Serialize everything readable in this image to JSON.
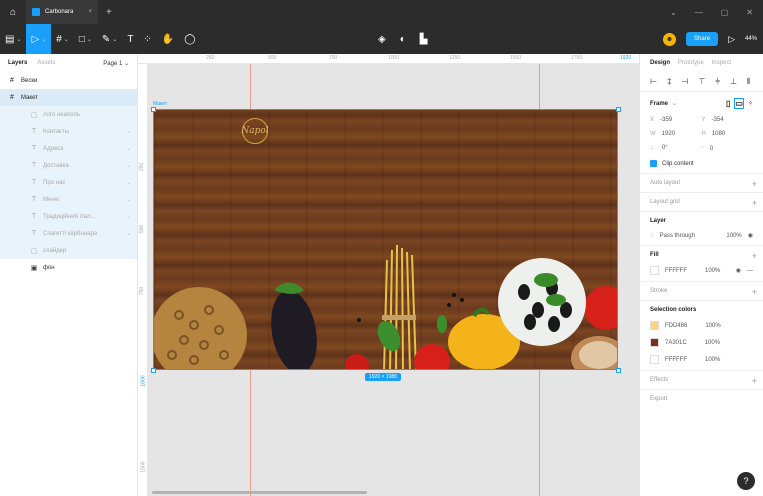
{
  "tab": {
    "title": "Carbonara",
    "close": "×",
    "new": "+"
  },
  "toolbar": {
    "share_label": "Share",
    "zoom": "44%",
    "avatar_initial": "☻"
  },
  "left_panel": {
    "tabs": [
      "Layers",
      "Assets"
    ],
    "page": "Page 1",
    "layers": [
      {
        "name": "Вески",
        "icon": "#"
      },
      {
        "name": "Макет",
        "icon": "#"
      }
    ],
    "children": [
      {
        "name": "лого неаполь",
        "icon": "▢"
      },
      {
        "name": "Контакты",
        "icon": "T"
      },
      {
        "name": "Адреса",
        "icon": "T"
      },
      {
        "name": "Доставка",
        "icon": "T"
      },
      {
        "name": "Про нас",
        "icon": "T"
      },
      {
        "name": "Меню",
        "icon": "T"
      },
      {
        "name": "Традиційний італ...",
        "icon": "T"
      },
      {
        "name": "Спагетті карбонара",
        "icon": "T"
      },
      {
        "name": "слайдер",
        "icon": "▢"
      },
      {
        "name": "фон",
        "icon": "▣"
      }
    ]
  },
  "rulers": {
    "top": [
      "250",
      "500",
      "750",
      "1000",
      "1250",
      "1500",
      "1750",
      "1920"
    ],
    "left": [
      "250",
      "500",
      "750",
      "1000",
      "1500"
    ]
  },
  "canvas": {
    "frame_name": "Макет",
    "size_label": "1920 × 1080",
    "logo_text": "Napol"
  },
  "right_panel": {
    "tabs": [
      "Design",
      "Prototype",
      "Inspect"
    ],
    "frame": {
      "title": "Frame",
      "x": "-359",
      "y": "-354",
      "w": "1920",
      "h": "1080",
      "rotation": "0°",
      "radius": "0",
      "clip_content": "Clip content"
    },
    "auto_layout": "Auto layout",
    "layout_grid": "Layout grid",
    "layer": {
      "title": "Layer",
      "blend": "Pass through",
      "opacity": "100%"
    },
    "fill": {
      "title": "Fill",
      "color": "FFFFFF",
      "opacity": "100%"
    },
    "stroke": "Stroke",
    "selection_colors": {
      "title": "Selection colors",
      "items": [
        {
          "hex": "FDD486",
          "opacity": "100%",
          "swatch": "#FDD486"
        },
        {
          "hex": "7A301C",
          "opacity": "100%",
          "swatch": "#7A301C"
        },
        {
          "hex": "FFFFFF",
          "opacity": "100%",
          "swatch": "#FFFFFF"
        }
      ]
    },
    "effects": "Effects",
    "export": "Export"
  },
  "colors": {
    "accent": "#18A0FB",
    "dark_bar": "#2C2C2C"
  }
}
